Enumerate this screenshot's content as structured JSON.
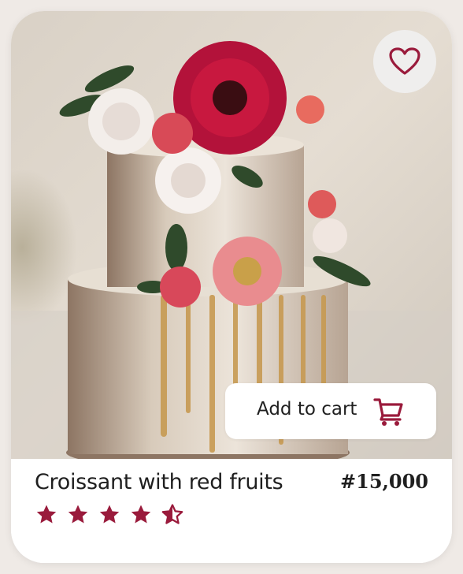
{
  "product": {
    "title": "Croissant with red fruits",
    "price": "#15,000",
    "rating": 4.5,
    "rating_max": 5,
    "image_subject": "naked two-tier cake with red and pink flowers"
  },
  "actions": {
    "add_to_cart_label": "Add to cart",
    "favorite_icon": "heart-icon",
    "cart_icon": "cart-icon"
  },
  "colors": {
    "accent": "#9a1b3c",
    "card_bg": "#ffffff",
    "fav_bg": "#efeeed"
  }
}
